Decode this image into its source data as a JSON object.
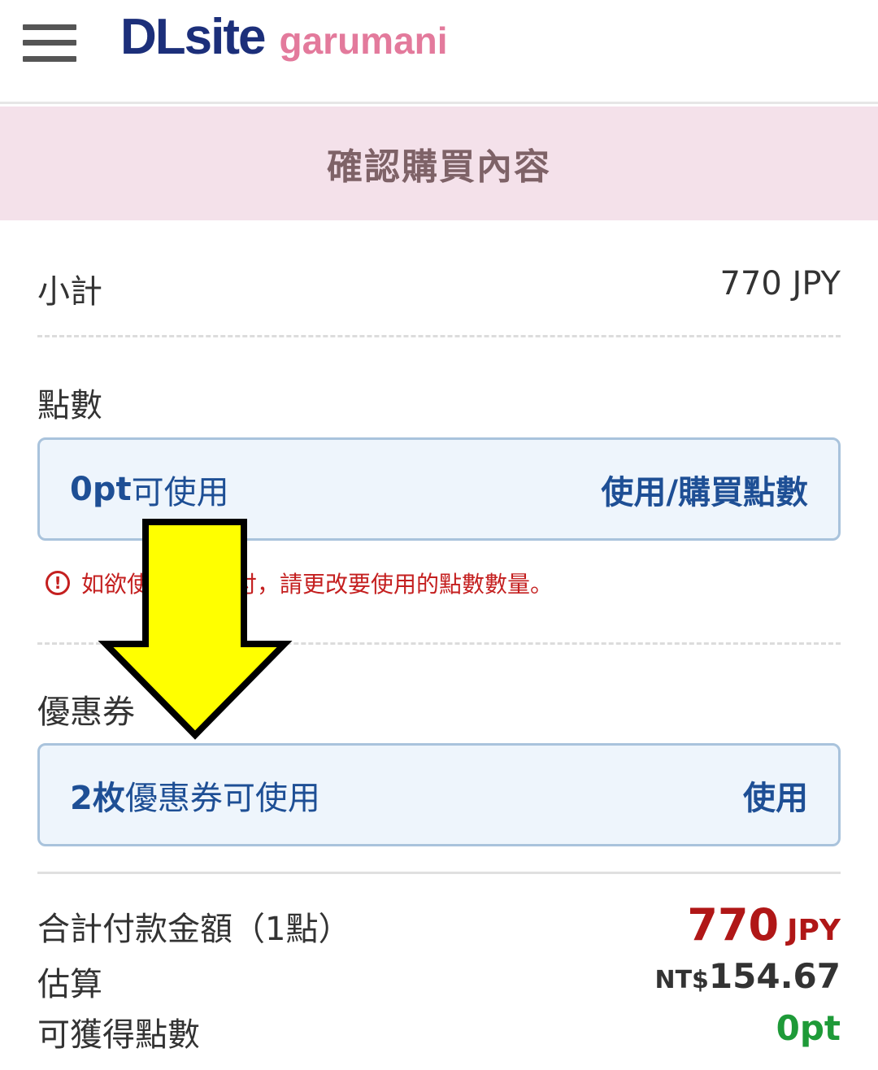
{
  "header": {
    "brand_main": "DLsite",
    "brand_sub": "garumani",
    "menu_icon": "hamburger-menu-icon"
  },
  "page_title": "確認購買內容",
  "subtotal": {
    "label": "小計",
    "value": "770 JPY"
  },
  "points": {
    "label": "點數",
    "available_value": "0pt",
    "available_suffix": "可使用",
    "action_label": "使用/購買點數",
    "warning_part1": "如欲使",
    "warning_part2": "付，請更改要使用的點數數量。",
    "warning_icon": "exclamation-circle-icon"
  },
  "coupon": {
    "label": "優惠券",
    "available_count": "2枚",
    "available_suffix": "優惠券可使用",
    "action_label": "使用"
  },
  "total": {
    "label": "合計付款金額（1點）",
    "amount": "770",
    "currency": "JPY",
    "estimate_label": "估算",
    "estimate_prefix": "NT$",
    "estimate_value": "154.67",
    "earn_label": "可獲得點數",
    "earn_value": "0pt"
  },
  "colors": {
    "brand_blue": "#1c2f7a",
    "brand_pink": "#e37a9c",
    "title_band": "#f4e1ea",
    "link_blue": "#1e4f95",
    "warning_red": "#c41f1f",
    "price_red": "#b01717",
    "points_green": "#1e9a38",
    "annotation_arrow": "#ffff00"
  },
  "annotation": {
    "icon": "yellow-arrow-down-icon"
  }
}
